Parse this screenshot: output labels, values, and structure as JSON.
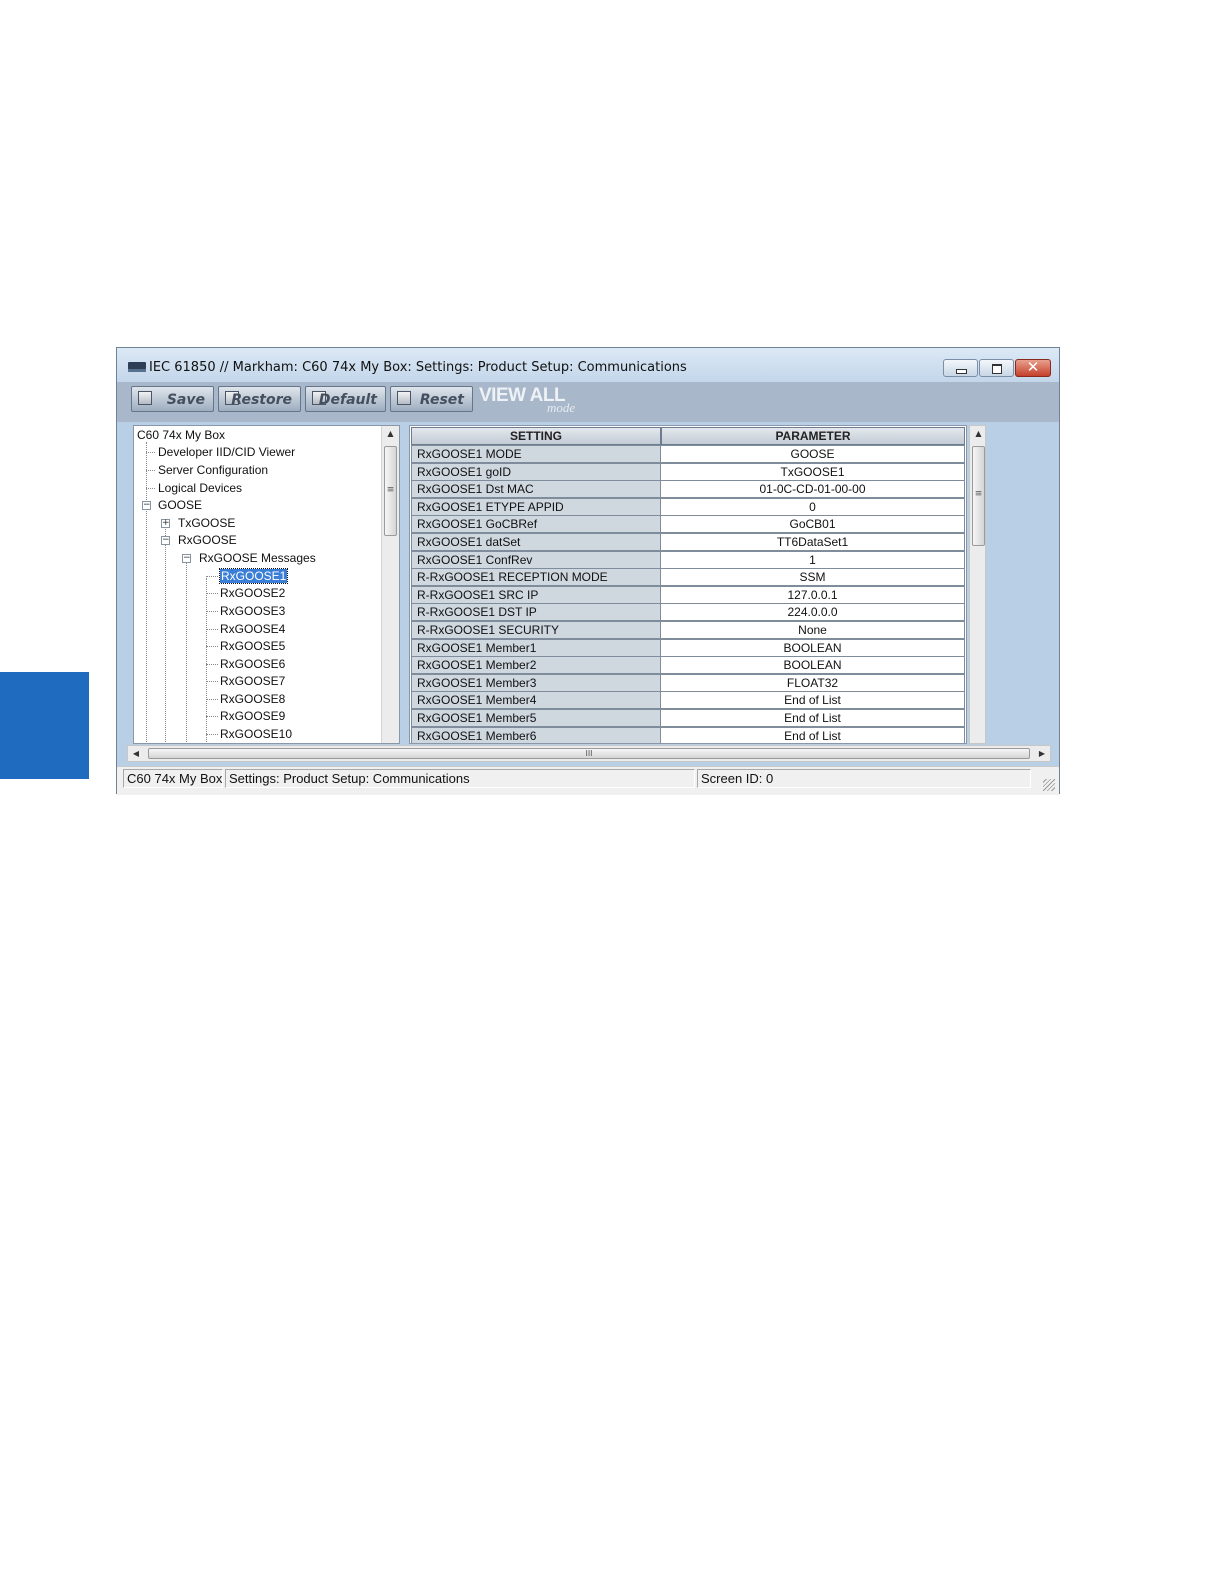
{
  "window": {
    "title": "IEC 61850 // Markham: C60 74x My Box: Settings: Product Setup: Communications",
    "controls": {
      "minimize": "minimize",
      "maximize": "maximize",
      "close": "✕"
    }
  },
  "toolbar": {
    "save_label": "Save",
    "restore_label": "Restore",
    "default_label": "Default",
    "reset_label": "Reset",
    "view_all": "VIEW ALL",
    "mode": "mode"
  },
  "tree": {
    "root": "C60 74x My Box",
    "items": [
      "Developer IID/CID Viewer",
      "Server Configuration",
      "Logical Devices",
      "GOOSE",
      "TxGOOSE",
      "RxGOOSE",
      "RxGOOSE Messages",
      "RxGOOSE1",
      "RxGOOSE2",
      "RxGOOSE3",
      "RxGOOSE4",
      "RxGOOSE5",
      "RxGOOSE6",
      "RxGOOSE7",
      "RxGOOSE8",
      "RxGOOSE9",
      "RxGOOSE10"
    ],
    "expanders": {
      "plus": "+",
      "minus": "−"
    }
  },
  "grid": {
    "headers": {
      "setting": "SETTING",
      "parameter": "PARAMETER"
    },
    "rows": [
      {
        "setting": "RxGOOSE1 MODE",
        "parameter": "GOOSE"
      },
      {
        "setting": "RxGOOSE1 goID",
        "parameter": "TxGOOSE1"
      },
      {
        "setting": "RxGOOSE1 Dst MAC",
        "parameter": "01-0C-CD-01-00-00"
      },
      {
        "setting": "RxGOOSE1 ETYPE APPID",
        "parameter": "0"
      },
      {
        "setting": "RxGOOSE1 GoCBRef",
        "parameter": "GoCB01"
      },
      {
        "setting": "RxGOOSE1 datSet",
        "parameter": "TT6DataSet1"
      },
      {
        "setting": "RxGOOSE1 ConfRev",
        "parameter": "1"
      },
      {
        "setting": "R-RxGOOSE1 RECEPTION MODE",
        "parameter": "SSM"
      },
      {
        "setting": "R-RxGOOSE1 SRC IP",
        "parameter": "127.0.0.1"
      },
      {
        "setting": "R-RxGOOSE1 DST IP",
        "parameter": "224.0.0.0"
      },
      {
        "setting": "R-RxGOOSE1 SECURITY",
        "parameter": "None"
      },
      {
        "setting": "RxGOOSE1 Member1",
        "parameter": "BOOLEAN"
      },
      {
        "setting": "RxGOOSE1 Member2",
        "parameter": "BOOLEAN"
      },
      {
        "setting": "RxGOOSE1 Member3",
        "parameter": "FLOAT32"
      },
      {
        "setting": "RxGOOSE1 Member4",
        "parameter": "End of List"
      },
      {
        "setting": "RxGOOSE1 Member5",
        "parameter": "End of List"
      },
      {
        "setting": "RxGOOSE1 Member6",
        "parameter": "End of List"
      }
    ]
  },
  "scroll": {
    "up": "▲",
    "down": "▼",
    "left": "◀",
    "right": "▶",
    "grip": "≡",
    "hgrip": "III"
  },
  "status": {
    "device": "C60 74x My Box",
    "path": "Settings: Product Setup: Communications",
    "screen_id": "Screen ID: 0"
  },
  "colors": {
    "accent_tab": "#1f6bc0",
    "selection": "#3a7ed7",
    "window_frame": "#b9cfe6"
  }
}
